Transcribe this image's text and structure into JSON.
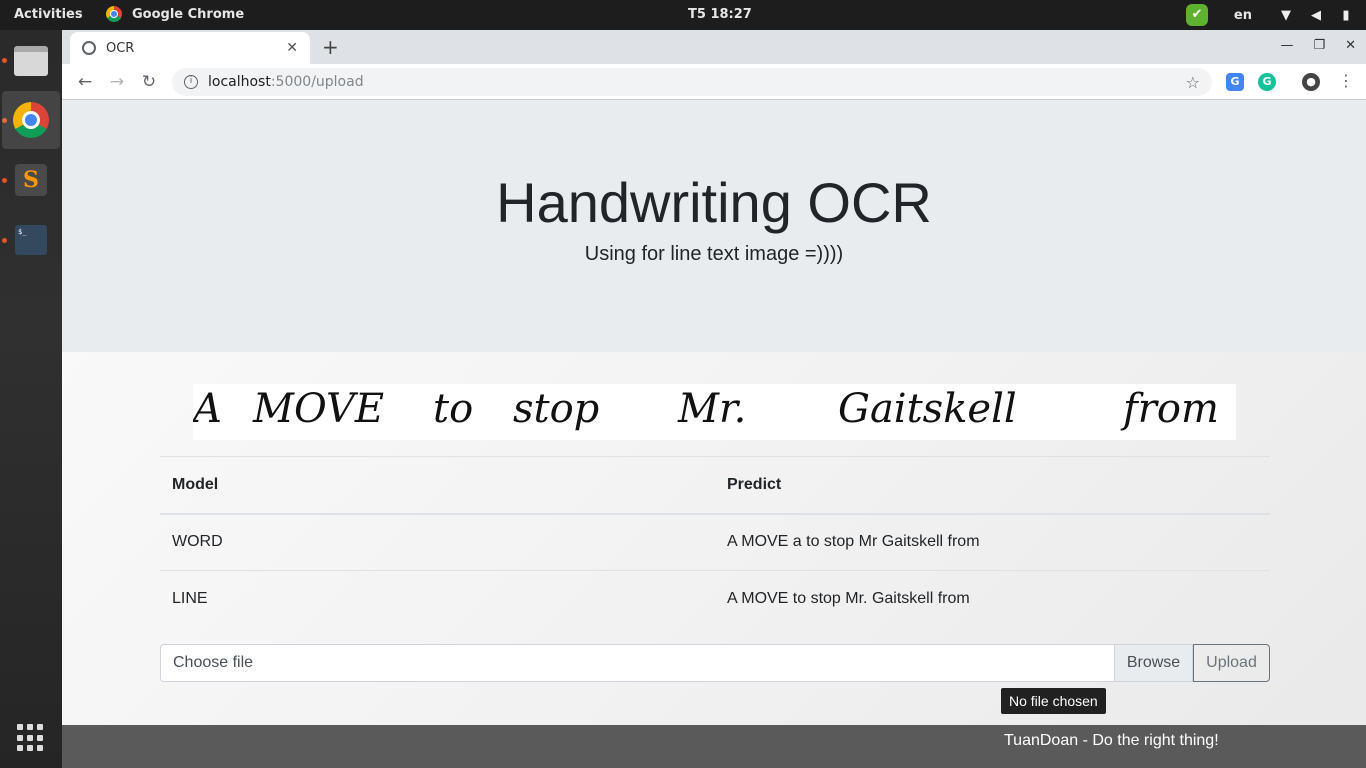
{
  "topbar": {
    "activities": "Activities",
    "app_name": "Google Chrome",
    "clock": "T5 18:27",
    "language": "en"
  },
  "browser": {
    "tab_title": "OCR",
    "url_host": "localhost",
    "url_path": ":5000/upload"
  },
  "page": {
    "title": "Handwriting OCR",
    "subtitle": "Using for line text image =))))",
    "handwriting_words": [
      "A",
      "MOVE",
      "to",
      "stop",
      "Mr.",
      "Gaitskell",
      "from"
    ],
    "table": {
      "headers": [
        "Model",
        "Predict"
      ],
      "rows": [
        {
          "model": "WORD",
          "predict": "A MOVE a to stop Mr Gaitskell from"
        },
        {
          "model": "LINE",
          "predict": "A MOVE to stop Mr. Gaitskell from"
        }
      ]
    },
    "file_input_label": "Choose file",
    "browse_label": "Browse",
    "upload_label": "Upload",
    "tooltip": "No file chosen",
    "footer": "TuanDoan - Do the right thing!"
  }
}
